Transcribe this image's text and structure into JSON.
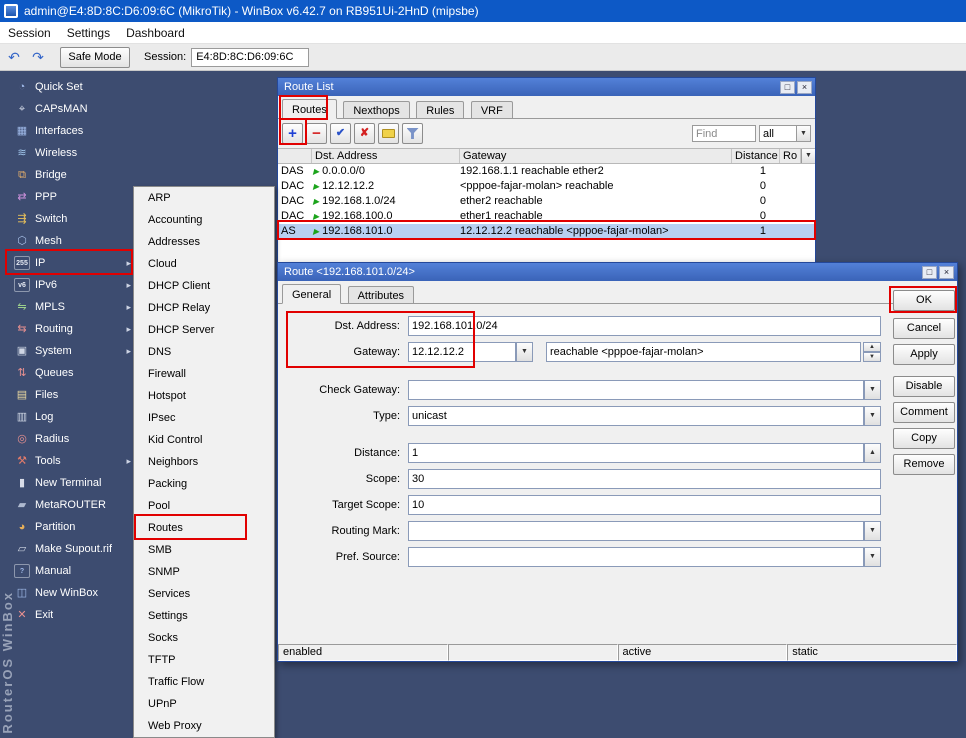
{
  "chrome": {
    "maximize": "□",
    "close": "×"
  },
  "icons": {
    "dropdown": "▼",
    "up": "▲",
    "undo": "↶",
    "redo": "↷"
  },
  "os_window": {
    "title": "admin@E4:8D:8C:D6:09:6C (MikroTik) - WinBox v6.42.7 on RB951Ui-2HnD (mipsbe)"
  },
  "menubar": {
    "items": [
      "Session",
      "Settings",
      "Dashboard"
    ]
  },
  "toolbar": {
    "safe_mode_label": "Safe Mode",
    "session_label": "Session:",
    "session_value": "E4:8D:8C:D6:09:6C"
  },
  "brand_vertical": "RouterOS WinBox",
  "sidebar": {
    "items": [
      {
        "label": "Quick Set",
        "icon": "quickset-icon",
        "glyph": "◔",
        "color": "#9fb9e8",
        "arrow": "",
        "txt": false
      },
      {
        "label": "CAPsMAN",
        "icon": "capsman-icon",
        "glyph": "⌖",
        "color": "#cfd6e4",
        "arrow": "",
        "txt": false
      },
      {
        "label": "Interfaces",
        "icon": "interfaces-icon",
        "glyph": "▦",
        "color": "#9fb9e8",
        "arrow": "",
        "txt": false
      },
      {
        "label": "Wireless",
        "icon": "wireless-icon",
        "glyph": "≋",
        "color": "#9fc4ea",
        "arrow": "",
        "txt": false
      },
      {
        "label": "Bridge",
        "icon": "bridge-icon",
        "glyph": "⧉",
        "color": "#e8b06a",
        "arrow": "",
        "txt": false
      },
      {
        "label": "PPP",
        "icon": "ppp-icon",
        "glyph": "⇄",
        "color": "#cf92de",
        "arrow": "",
        "txt": false
      },
      {
        "label": "Switch",
        "icon": "switch-icon",
        "glyph": "⇶",
        "color": "#e8c05a",
        "arrow": "",
        "txt": false
      },
      {
        "label": "Mesh",
        "icon": "mesh-icon",
        "glyph": "⬡",
        "color": "#a8c0e8",
        "arrow": "",
        "txt": false
      },
      {
        "label": "IP",
        "icon": "ip-icon",
        "glyph": "255",
        "color": "#e4e8f2",
        "arrow": "▸",
        "txt": true
      },
      {
        "label": "IPv6",
        "icon": "ipv6-icon",
        "glyph": "v6",
        "color": "#e4e8f2",
        "arrow": "▸",
        "txt": true
      },
      {
        "label": "MPLS",
        "icon": "mpls-icon",
        "glyph": "⇋",
        "color": "#9cd08c",
        "arrow": "▸",
        "txt": false
      },
      {
        "label": "Routing",
        "icon": "routing-icon",
        "glyph": "⇆",
        "color": "#e89090",
        "arrow": "▸",
        "txt": false
      },
      {
        "label": "System",
        "icon": "system-icon",
        "glyph": "▣",
        "color": "#cfd6e4",
        "arrow": "▸",
        "txt": false
      },
      {
        "label": "Queues",
        "icon": "queues-icon",
        "glyph": "⇅",
        "color": "#e89090",
        "arrow": "",
        "txt": false
      },
      {
        "label": "Files",
        "icon": "files-icon",
        "glyph": "▤",
        "color": "#ead9a0",
        "arrow": "",
        "txt": false
      },
      {
        "label": "Log",
        "icon": "log-icon",
        "glyph": "▥",
        "color": "#cfd6e4",
        "arrow": "",
        "txt": false
      },
      {
        "label": "Radius",
        "icon": "radius-icon",
        "glyph": "◎",
        "color": "#e89090",
        "arrow": "",
        "txt": false
      },
      {
        "label": "Tools",
        "icon": "tools-icon",
        "glyph": "⚒",
        "color": "#e07a6a",
        "arrow": "▸",
        "txt": false
      },
      {
        "label": "New Terminal",
        "icon": "new-terminal-icon",
        "glyph": "▮",
        "color": "#d8dce8",
        "arrow": "",
        "txt": false
      },
      {
        "label": "MetaROUTER",
        "icon": "metarouter-icon",
        "glyph": "▰",
        "color": "#aeb9cf",
        "arrow": "",
        "txt": false
      },
      {
        "label": "Partition",
        "icon": "partition-icon",
        "glyph": "◕",
        "color": "#e8b05a",
        "arrow": "",
        "txt": false
      },
      {
        "label": "Make Supout.rif",
        "icon": "supout-icon",
        "glyph": "▱",
        "color": "#cfd6e4",
        "arrow": "",
        "txt": false
      },
      {
        "label": "Manual",
        "icon": "manual-icon",
        "glyph": "?",
        "color": "#9fb9e8",
        "arrow": "",
        "txt": true
      },
      {
        "label": "New WinBox",
        "icon": "new-winbox-icon",
        "glyph": "◫",
        "color": "#9fb9e8",
        "arrow": "",
        "txt": false
      },
      {
        "label": "Exit",
        "icon": "exit-icon",
        "glyph": "✕",
        "color": "#e89090",
        "arrow": "",
        "txt": false
      }
    ]
  },
  "submenu": {
    "items": [
      "ARP",
      "Accounting",
      "Addresses",
      "Cloud",
      "DHCP Client",
      "DHCP Relay",
      "DHCP Server",
      "DNS",
      "Firewall",
      "Hotspot",
      "IPsec",
      "Kid Control",
      "Neighbors",
      "Packing",
      "Pool",
      "Routes",
      "SMB",
      "SNMP",
      "Services",
      "Settings",
      "Socks",
      "TFTP",
      "Traffic Flow",
      "UPnP",
      "Web Proxy"
    ]
  },
  "route_list": {
    "title": "Route List",
    "tabs": [
      "Routes",
      "Nexthops",
      "Rules",
      "VRF"
    ],
    "tool": {
      "add": "+",
      "remove": "−",
      "enable": "✔",
      "disable": "✘"
    },
    "find_placeholder": "Find",
    "filter_value": "all",
    "columns": [
      "",
      "Dst. Address",
      "Gateway",
      "Distance",
      "Ro"
    ],
    "rows": [
      {
        "flags": "DAS",
        "marker": "▶",
        "dst": "0.0.0.0/0",
        "gateway": "192.168.1.1 reachable ether2",
        "distance": "1",
        "selected": false
      },
      {
        "flags": "DAC",
        "marker": "▶",
        "dst": "12.12.12.2",
        "gateway": "<pppoe-fajar-molan> reachable",
        "distance": "0",
        "selected": false
      },
      {
        "flags": "DAC",
        "marker": "▶",
        "dst": "192.168.1.0/24",
        "gateway": "ether2 reachable",
        "distance": "0",
        "selected": false
      },
      {
        "flags": "DAC",
        "marker": "▶",
        "dst": "192.168.100.0",
        "gateway": "ether1 reachable",
        "distance": "0",
        "selected": false
      },
      {
        "flags": "AS",
        "marker": "▶",
        "dst": "192.168.101.0",
        "gateway": "12.12.12.2 reachable <pppoe-fajar-molan>",
        "distance": "1",
        "selected": true
      }
    ]
  },
  "route_dialog": {
    "title": "Route <192.168.101.0/24>",
    "tabs": [
      "General",
      "Attributes"
    ],
    "fields": {
      "dst_address": {
        "label": "Dst. Address:",
        "value": "192.168.101.0/24"
      },
      "gateway": {
        "label": "Gateway:",
        "value": "12.12.12.2",
        "status": "reachable <pppoe-fajar-molan>"
      },
      "check_gateway": {
        "label": "Check Gateway:",
        "value": ""
      },
      "type": {
        "label": "Type:",
        "value": "unicast"
      },
      "distance": {
        "label": "Distance:",
        "value": "1"
      },
      "scope": {
        "label": "Scope:",
        "value": "30"
      },
      "target_scope": {
        "label": "Target Scope:",
        "value": "10"
      },
      "routing_mark": {
        "label": "Routing Mark:",
        "value": ""
      },
      "pref_source": {
        "label": "Pref. Source:",
        "value": ""
      }
    },
    "buttons": [
      "OK",
      "Cancel",
      "Apply",
      "Disable",
      "Comment",
      "Copy",
      "Remove"
    ],
    "status_cells": [
      "enabled",
      "",
      "active",
      "static"
    ]
  }
}
